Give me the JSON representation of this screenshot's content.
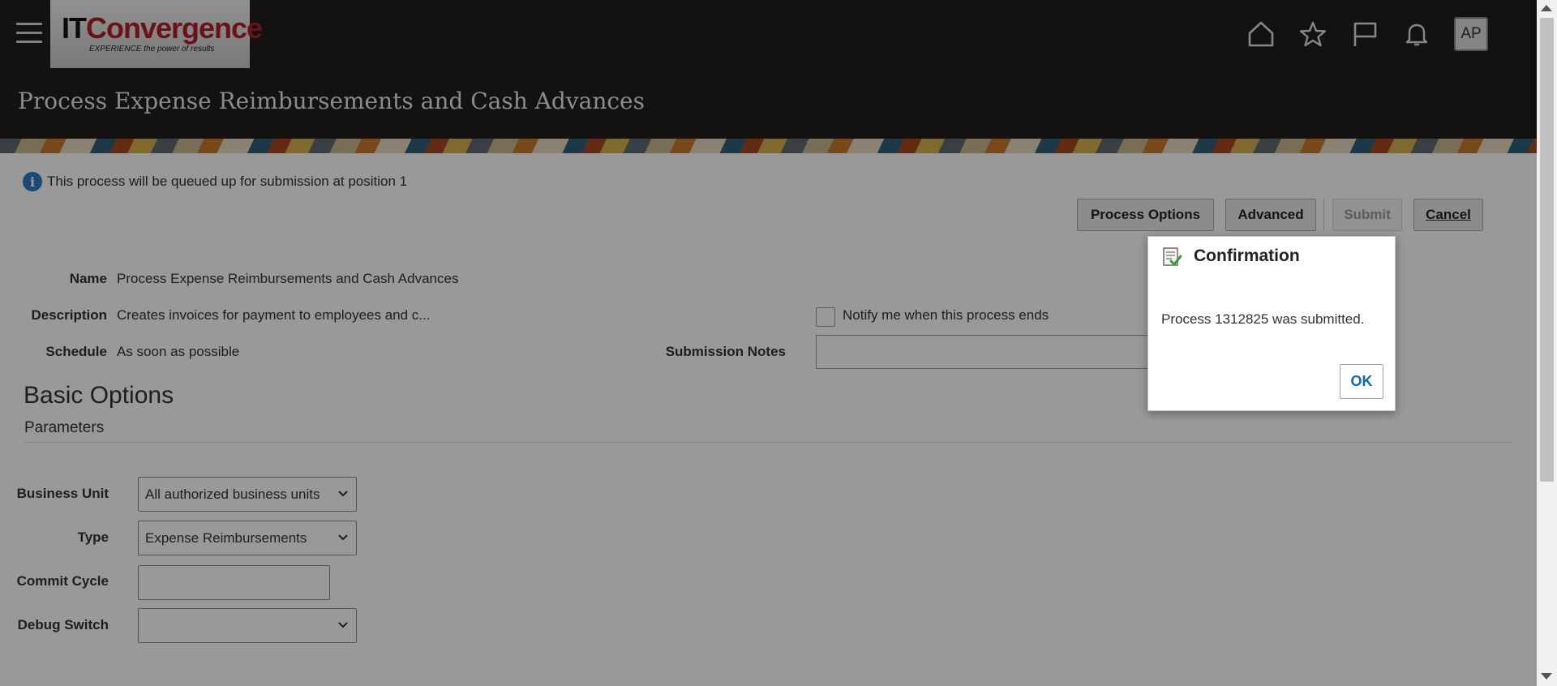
{
  "header": {
    "logo": {
      "text_part1": "IT",
      "text_part2": "Convergence",
      "tagline": "EXPERIENCE the power of results"
    },
    "menu_icon": "hamburger-menu-icon",
    "icons": [
      "home-icon",
      "favorites-star-icon",
      "flag-icon",
      "notifications-bell-icon"
    ],
    "avatar_initials": "AP",
    "page_title": "Process Expense Reimbursements and Cash Advances"
  },
  "info_message": "This process will be queued up for submission at position 1",
  "toolbar": {
    "process_options": "Process Options",
    "advanced": "Advanced",
    "submit": "Submit",
    "cancel": "Cancel"
  },
  "details": {
    "name_label": "Name",
    "name_value": "Process Expense Reimbursements and Cash Advances",
    "description_label": "Description",
    "description_value": "Creates invoices for payment to employees and c...",
    "schedule_label": "Schedule",
    "schedule_value": "As soon as possible",
    "notify_label": "Notify me when this process ends",
    "submission_notes_label": "Submission Notes",
    "submission_notes_value": ""
  },
  "basic_options": {
    "title": "Basic Options",
    "subtitle": "Parameters",
    "fields": {
      "business_unit_label": "Business Unit",
      "business_unit_value": "All authorized business units",
      "type_label": "Type",
      "type_value": "Expense Reimbursements",
      "commit_cycle_label": "Commit Cycle",
      "commit_cycle_value": "",
      "debug_switch_label": "Debug Switch",
      "debug_switch_value": ""
    }
  },
  "dialog": {
    "title": "Confirmation",
    "message": "Process 1312825 was submitted.",
    "ok": "OK"
  },
  "colors": {
    "header_bg": "#211e1c",
    "link_blue": "#0b6bb5",
    "info_blue": "#2f7cc1"
  }
}
